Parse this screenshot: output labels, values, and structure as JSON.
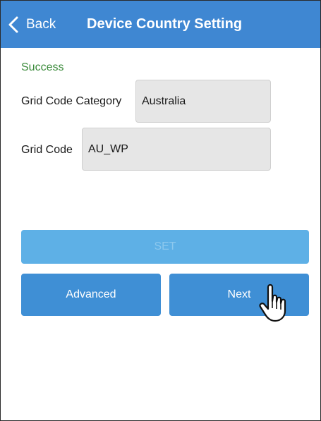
{
  "header": {
    "back_label": "Back",
    "title": "Device Country Setting",
    "color": "#3f87d2"
  },
  "status": {
    "text": "Success",
    "color": "#3a8a3a"
  },
  "form": {
    "category_label": "Grid Code Category",
    "category_value": "Australia",
    "code_label": "Grid Code",
    "code_value": "AU_WP"
  },
  "buttons": {
    "set_label": "SET",
    "advanced_label": "Advanced",
    "next_label": "Next"
  },
  "icons": {
    "back": "chevron-left-icon",
    "pointer": "hand-pointer-icon"
  }
}
